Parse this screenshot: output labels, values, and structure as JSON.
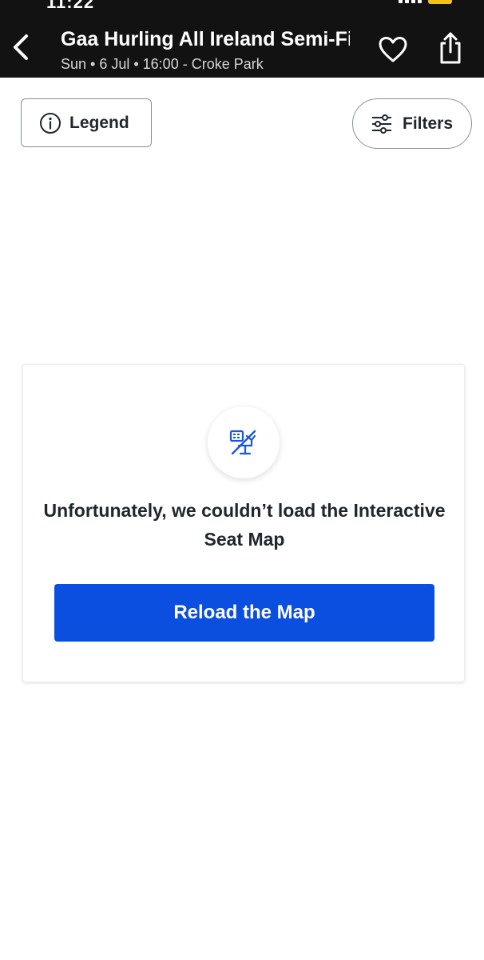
{
  "status_bar": {
    "time": "11:22"
  },
  "header": {
    "title": "Gaa Hurling All Ireland Semi-Final",
    "subtitle": "Sun • 6 Jul • 16:00 - Croke Park",
    "icons": {
      "back": "chevron-left-icon",
      "favorite": "heart-icon",
      "share": "share-icon"
    }
  },
  "toolbar": {
    "legend_label": "Legend",
    "filters_label": "Filters",
    "icons": {
      "legend": "info-icon",
      "filters": "sliders-icon"
    }
  },
  "error_card": {
    "icon": "map-unavailable-icon",
    "message": "Unfortunately, we couldn’t load the Interactive Seat Map",
    "reload_label": "Reload the Map"
  },
  "colors": {
    "header_bg": "#121212",
    "primary_button": "#0a4fe0",
    "icon_accent": "#1a56db"
  }
}
